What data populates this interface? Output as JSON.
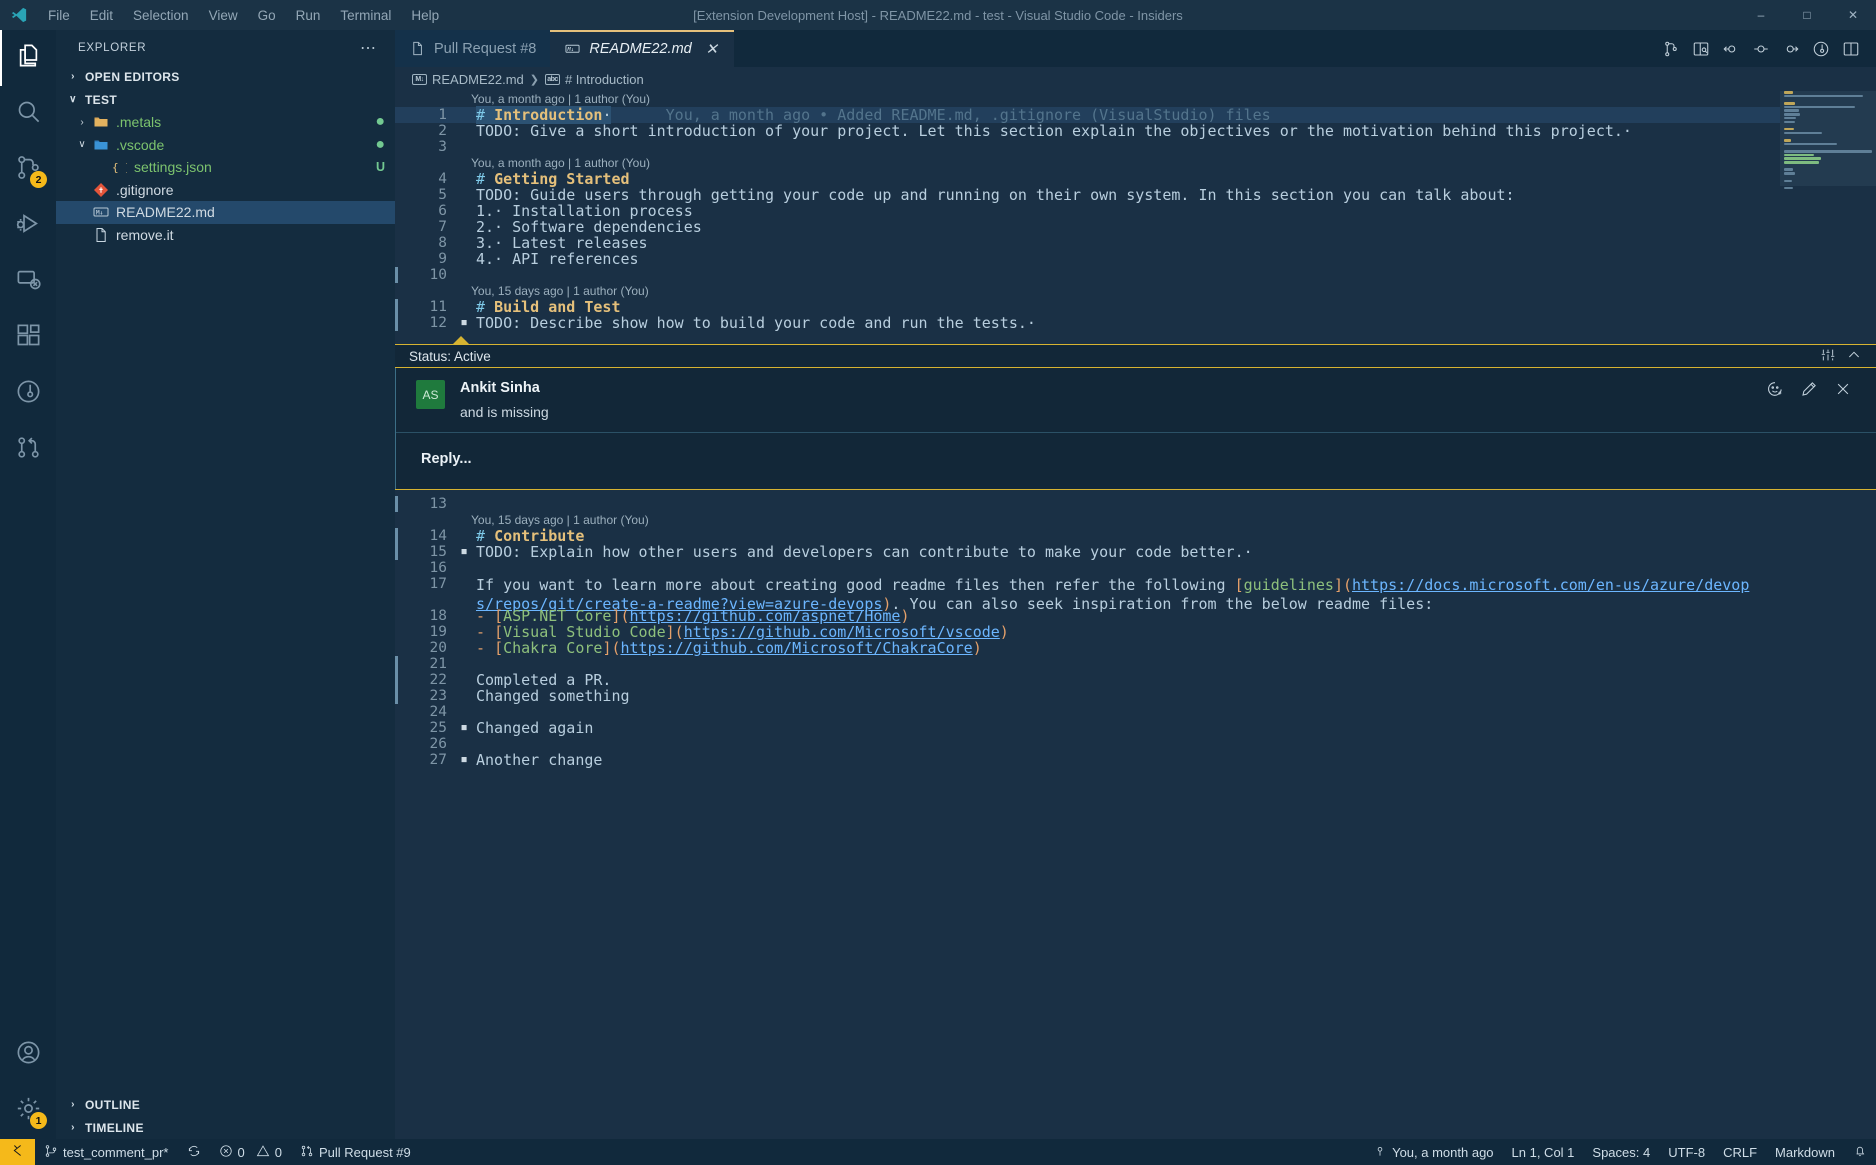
{
  "titlebar": {
    "title": "[Extension Development Host] - README22.md - test - Visual Studio Code - Insiders",
    "menus": [
      "File",
      "Edit",
      "Selection",
      "View",
      "Go",
      "Run",
      "Terminal",
      "Help"
    ],
    "window_buttons": [
      "minimize",
      "maximize",
      "close"
    ]
  },
  "activitybar": {
    "items": [
      {
        "name": "explorer",
        "icon": "files-icon",
        "active": true,
        "badge": null
      },
      {
        "name": "search",
        "icon": "search-icon",
        "active": false,
        "badge": null
      },
      {
        "name": "source-control",
        "icon": "source-control-icon",
        "active": false,
        "badge": "2"
      },
      {
        "name": "run-and-debug",
        "icon": "debug-icon",
        "active": false,
        "badge": null
      },
      {
        "name": "remote-explorer",
        "icon": "remote-icon",
        "active": false,
        "badge": null
      },
      {
        "name": "extensions",
        "icon": "extensions-icon",
        "active": false,
        "badge": null
      },
      {
        "name": "testing",
        "icon": "beaker-icon",
        "active": false,
        "badge": null
      },
      {
        "name": "pull-requests",
        "icon": "git-pull-request-icon",
        "active": false,
        "badge": null
      }
    ],
    "bottom": [
      {
        "name": "accounts",
        "icon": "account-icon",
        "badge": null
      },
      {
        "name": "manage",
        "icon": "gear-icon",
        "badge": "1"
      }
    ]
  },
  "sidebar": {
    "header": "EXPLORER",
    "more_actions": "⋯",
    "sections": [
      {
        "label": "OPEN EDITORS",
        "expanded": false
      },
      {
        "label": "TEST",
        "expanded": true
      }
    ],
    "tree": [
      {
        "label": ".metals",
        "kind": "folder",
        "indent": 1,
        "twisty": "›",
        "color": "green",
        "decoration": "dot",
        "selected": false
      },
      {
        "label": ".vscode",
        "kind": "folder-open",
        "indent": 1,
        "twisty": "∨",
        "color": "green",
        "decoration": "dot",
        "selected": false
      },
      {
        "label": "settings.json",
        "kind": "json",
        "indent": 2,
        "twisty": "",
        "color": "green",
        "decoration": "U",
        "selected": false
      },
      {
        "label": ".gitignore",
        "kind": "git",
        "indent": 1,
        "twisty": "",
        "color": "plain",
        "decoration": "",
        "selected": false
      },
      {
        "label": "README22.md",
        "kind": "markdown",
        "indent": 1,
        "twisty": "",
        "color": "plain",
        "decoration": "",
        "selected": true
      },
      {
        "label": "remove.it",
        "kind": "file",
        "indent": 1,
        "twisty": "",
        "color": "plain",
        "decoration": "",
        "selected": false
      }
    ],
    "footer_sections": [
      {
        "label": "OUTLINE",
        "expanded": false
      },
      {
        "label": "TIMELINE",
        "expanded": false
      }
    ]
  },
  "tabs": [
    {
      "label": "Pull Request #8",
      "icon": "file-icon",
      "active": false,
      "closable": false
    },
    {
      "label": "README22.md",
      "icon": "markdown-icon",
      "active": true,
      "closable": true,
      "close_glyph": "✕"
    }
  ],
  "editor_actions": [
    {
      "name": "open-changes-icon"
    },
    {
      "name": "open-preview-to-side-icon"
    },
    {
      "name": "previous-change-icon"
    },
    {
      "name": "toggle-inline-change-icon"
    },
    {
      "name": "next-change-icon"
    },
    {
      "name": "timeline-icon"
    },
    {
      "name": "split-editor-icon"
    }
  ],
  "breadcrumb": [
    {
      "label": "README22.md",
      "icon": "markdown-icon"
    },
    {
      "label": "# Introduction",
      "icon": "symbol-string-icon"
    }
  ],
  "editor": {
    "lines": [
      {
        "n": 1,
        "blame": "You, a month ago | 1 author (You)",
        "segments": [
          {
            "t": "# ",
            "c": "hash"
          },
          {
            "t": "Introduction",
            "c": "kw-head"
          },
          {
            "t": "·",
            "c": "txt"
          }
        ],
        "inline_blame": "You, a month ago • Added README.md, .gitignore (VisualStudio) files",
        "highlight": true,
        "selection": true,
        "fold": false,
        "changebar": false
      },
      {
        "n": 2,
        "blame": null,
        "segments": [
          {
            "t": "TODO: Give a short introduction of your project. Let this section explain the objectives or the motivation behind this project.·",
            "c": "txt"
          }
        ],
        "inline_blame": null,
        "highlight": false,
        "selection": false,
        "fold": false,
        "changebar": false
      },
      {
        "n": 3,
        "blame": null,
        "segments": [],
        "inline_blame": null,
        "highlight": false,
        "selection": false,
        "fold": false,
        "changebar": false
      },
      {
        "n": 4,
        "blame": "You, a month ago | 1 author (You)",
        "segments": [
          {
            "t": "# ",
            "c": "hash"
          },
          {
            "t": "Getting Started",
            "c": "kw-head"
          }
        ],
        "inline_blame": null,
        "highlight": false,
        "selection": false,
        "fold": false,
        "changebar": false
      },
      {
        "n": 5,
        "blame": null,
        "segments": [
          {
            "t": "TODO: Guide users through getting your code up and running on their own system. In this section you can talk about:",
            "c": "txt"
          }
        ],
        "inline_blame": null,
        "highlight": false,
        "selection": false,
        "fold": false,
        "changebar": false
      },
      {
        "n": 6,
        "blame": null,
        "segments": [
          {
            "t": "1.· Installation process",
            "c": "txt"
          }
        ],
        "inline_blame": null,
        "highlight": false,
        "selection": false,
        "fold": false,
        "changebar": false
      },
      {
        "n": 7,
        "blame": null,
        "segments": [
          {
            "t": "2.· Software dependencies",
            "c": "txt"
          }
        ],
        "inline_blame": null,
        "highlight": false,
        "selection": false,
        "fold": false,
        "changebar": false
      },
      {
        "n": 8,
        "blame": null,
        "segments": [
          {
            "t": "3.· Latest releases",
            "c": "txt"
          }
        ],
        "inline_blame": null,
        "highlight": false,
        "selection": false,
        "fold": false,
        "changebar": false
      },
      {
        "n": 9,
        "blame": null,
        "segments": [
          {
            "t": "4.· API references",
            "c": "txt"
          }
        ],
        "inline_blame": null,
        "highlight": false,
        "selection": false,
        "fold": false,
        "changebar": false
      },
      {
        "n": 10,
        "blame": null,
        "segments": [],
        "inline_blame": null,
        "highlight": false,
        "selection": false,
        "fold": false,
        "changebar": true
      },
      {
        "n": 11,
        "blame": "You, 15 days ago | 1 author (You)",
        "segments": [
          {
            "t": "# ",
            "c": "hash"
          },
          {
            "t": "Build and Test",
            "c": "kw-head"
          }
        ],
        "inline_blame": null,
        "highlight": false,
        "selection": false,
        "fold": false,
        "changebar": true
      },
      {
        "n": 12,
        "blame": null,
        "segments": [
          {
            "t": "TODO: Describe show how to build your code and run the tests.·",
            "c": "txt"
          }
        ],
        "inline_blame": null,
        "highlight": false,
        "selection": false,
        "fold": true,
        "changebar": true
      }
    ],
    "lines_after": [
      {
        "n": 13,
        "blame": null,
        "segments": [],
        "inline_blame": null,
        "fold": false,
        "changebar": true
      },
      {
        "n": 14,
        "blame": "You, 15 days ago | 1 author (You)",
        "segments": [
          {
            "t": "# ",
            "c": "hash"
          },
          {
            "t": "Contribute",
            "c": "kw-head"
          }
        ],
        "inline_blame": null,
        "fold": false,
        "changebar": true
      },
      {
        "n": 15,
        "blame": null,
        "segments": [
          {
            "t": "TODO: Explain how other users and developers can contribute to make your code better.·",
            "c": "txt"
          }
        ],
        "inline_blame": null,
        "fold": true,
        "changebar": true
      },
      {
        "n": 16,
        "blame": null,
        "segments": [],
        "inline_blame": null,
        "fold": false,
        "changebar": false
      },
      {
        "n": 17,
        "blame": null,
        "segments": [
          {
            "t": "If you want to learn more about creating good readme files then refer the following ",
            "c": "txt"
          },
          {
            "t": "[",
            "c": "orng"
          },
          {
            "t": "guidelines",
            "c": "grn"
          },
          {
            "t": "](",
            "c": "orng"
          },
          {
            "t": "https://docs.microsoft.com/en-us/azure/devops/repos/git/create-a-readme?view=azure-devops",
            "c": "lnk"
          },
          {
            "t": ")",
            "c": "orng"
          },
          {
            "t": ". You can also seek inspiration from the below readme files:",
            "c": "txt"
          }
        ],
        "inline_blame": null,
        "fold": false,
        "changebar": false,
        "wrapped": true
      },
      {
        "n": 18,
        "blame": null,
        "segments": [
          {
            "t": "- ",
            "c": "orng"
          },
          {
            "t": "[",
            "c": "orng"
          },
          {
            "t": "ASP.NET Core",
            "c": "grn"
          },
          {
            "t": "](",
            "c": "orng"
          },
          {
            "t": "https://github.com/aspnet/Home",
            "c": "lnk"
          },
          {
            "t": ")",
            "c": "orng"
          }
        ],
        "inline_blame": null,
        "fold": false,
        "changebar": false
      },
      {
        "n": 19,
        "blame": null,
        "segments": [
          {
            "t": "- ",
            "c": "orng"
          },
          {
            "t": "[",
            "c": "orng"
          },
          {
            "t": "Visual Studio Code",
            "c": "grn"
          },
          {
            "t": "](",
            "c": "orng"
          },
          {
            "t": "https://github.com/Microsoft/vscode",
            "c": "lnk"
          },
          {
            "t": ")",
            "c": "orng"
          }
        ],
        "inline_blame": null,
        "fold": false,
        "changebar": false
      },
      {
        "n": 20,
        "blame": null,
        "segments": [
          {
            "t": "- ",
            "c": "orng"
          },
          {
            "t": "[",
            "c": "orng"
          },
          {
            "t": "Chakra Core",
            "c": "grn"
          },
          {
            "t": "](",
            "c": "orng"
          },
          {
            "t": "https://github.com/Microsoft/ChakraCore",
            "c": "lnk"
          },
          {
            "t": ")",
            "c": "orng"
          }
        ],
        "inline_blame": null,
        "fold": false,
        "changebar": false
      },
      {
        "n": 21,
        "blame": null,
        "segments": [],
        "inline_blame": null,
        "fold": false,
        "changebar": true
      },
      {
        "n": 22,
        "blame": null,
        "segments": [
          {
            "t": "Completed a PR.",
            "c": "txt"
          }
        ],
        "inline_blame": null,
        "fold": false,
        "changebar": true
      },
      {
        "n": 23,
        "blame": null,
        "segments": [
          {
            "t": "Changed something",
            "c": "txt"
          }
        ],
        "inline_blame": null,
        "fold": false,
        "changebar": true
      },
      {
        "n": 24,
        "blame": null,
        "segments": [],
        "inline_blame": null,
        "fold": false,
        "changebar": false
      },
      {
        "n": 25,
        "blame": null,
        "segments": [
          {
            "t": "Changed again",
            "c": "txt"
          }
        ],
        "inline_blame": null,
        "fold": true,
        "changebar": false
      },
      {
        "n": 26,
        "blame": null,
        "segments": [],
        "inline_blame": null,
        "fold": false,
        "changebar": false
      },
      {
        "n": 27,
        "blame": null,
        "segments": [
          {
            "t": "Another change",
            "c": "txt"
          }
        ],
        "inline_blame": null,
        "fold": true,
        "changebar": false
      }
    ]
  },
  "comment_thread": {
    "status_label": "Status: Active",
    "status_actions": [
      {
        "name": "thread-settings-icon"
      },
      {
        "name": "collapse-chevron-up-icon"
      }
    ],
    "comment": {
      "avatar_initials": "AS",
      "author": "Ankit Sinha",
      "body": "and is missing"
    },
    "actions": [
      {
        "name": "add-reaction-icon"
      },
      {
        "name": "edit-comment-icon"
      },
      {
        "name": "delete-comment-icon"
      }
    ],
    "reply_placeholder": "Reply..."
  },
  "statusbar": {
    "remote_label": "",
    "left": [
      {
        "name": "branch",
        "icon": "source-control-icon",
        "label": "test_comment_pr*"
      },
      {
        "name": "sync",
        "icon": "sync-icon",
        "label": ""
      },
      {
        "name": "problems",
        "icon": "error-icon",
        "label": "0",
        "icon2": "warning-icon",
        "label2": "0"
      },
      {
        "name": "pull-request",
        "icon": "git-pull-request-icon",
        "label": "Pull Request #9"
      }
    ],
    "right": [
      {
        "name": "git-blame",
        "icon": "git-commit-icon",
        "label": "You, a month ago"
      },
      {
        "name": "cursor-position",
        "label": "Ln 1, Col 1"
      },
      {
        "name": "indentation",
        "label": "Spaces: 4"
      },
      {
        "name": "encoding",
        "label": "UTF-8"
      },
      {
        "name": "eol",
        "label": "CRLF"
      },
      {
        "name": "language-mode",
        "label": "Markdown"
      },
      {
        "name": "notifications",
        "icon": "bell-icon",
        "label": ""
      }
    ]
  },
  "colors": {
    "accent_yellow": "#d6b331",
    "editor_bg": "#1a3045",
    "sidebar_bg": "#142c3f",
    "activitybar_bg": "#11293c",
    "heading": "#e5c07b",
    "link": "#6cb6ff",
    "link_text": "#8ec07c",
    "avatar_bg": "#1f7a3d",
    "badge_bg": "#f5b91a"
  }
}
